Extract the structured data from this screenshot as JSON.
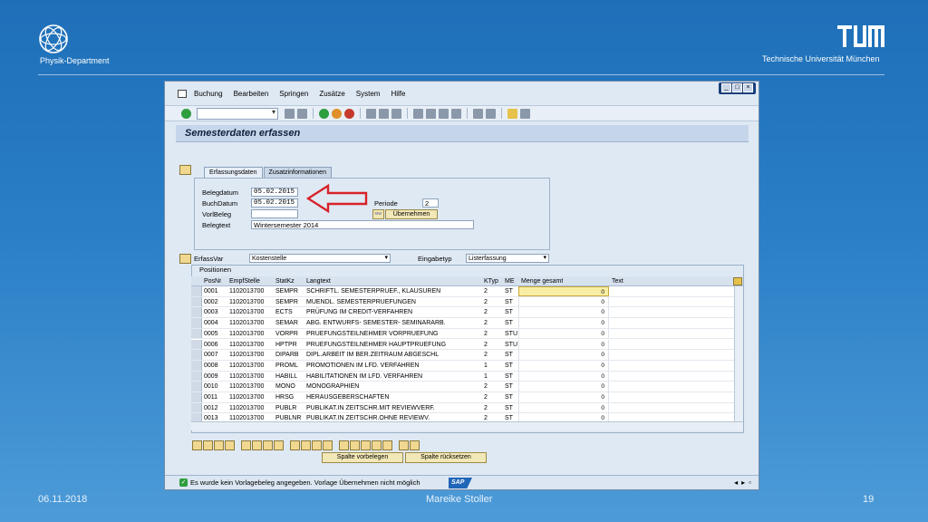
{
  "slide": {
    "department": "Physik-Department",
    "university": "Technische Universität München",
    "footer_date": "06.11.2018",
    "footer_author": "Mareike Stoller",
    "footer_page": "19"
  },
  "sap": {
    "menu": [
      "Buchung",
      "Bearbeiten",
      "Springen",
      "Zusätze",
      "System",
      "Hilfe"
    ],
    "title": "Semesterdaten erfassen",
    "tabs": [
      "Erfassungsdaten",
      "Zusatzinformationen"
    ],
    "form": {
      "belegdatum_label": "Belegdatum",
      "belegdatum_value": "05.02.2015",
      "buchdatum_label": "BuchDatum",
      "buchdatum_value": "05.02.2015",
      "vorlbeleg_label": "VorlBeleg",
      "belegtext_label": "Belegtext",
      "belegtext_value": "Wintersemester 2014",
      "periode_label": "Periode",
      "periode_value": "2",
      "uebernehmen_label": "Übernehmen"
    },
    "erfassvar_label": "ErfassVar",
    "erfassvar_value": "Kostenstelle",
    "eingabetyp_label": "Eingabetyp",
    "eingabetyp_value": "Listerfassung",
    "positions_title": "Positionen",
    "columns": [
      "PosNr",
      "EmpfStelle",
      "StatKz",
      "Langtext",
      "KTyp",
      "ME",
      "Menge gesamt",
      "Text"
    ],
    "rows": [
      {
        "posnr": "0001",
        "empf": "1102013700",
        "statkz": "SEMPR",
        "langtext": "SCHRIFTL. SEMESTERPRUEF., KLAUSUREN",
        "ktyp": "2",
        "me": "ST",
        "menge": "0"
      },
      {
        "posnr": "0002",
        "empf": "1102013700",
        "statkz": "SEMPR",
        "langtext": "MUENDL. SEMESTERPRUEFUNGEN",
        "ktyp": "2",
        "me": "ST",
        "menge": "0"
      },
      {
        "posnr": "0003",
        "empf": "1102013700",
        "statkz": "ECTS",
        "langtext": "PRÜFUNG IM CREDIT-VERFAHREN",
        "ktyp": "2",
        "me": "ST",
        "menge": "0"
      },
      {
        "posnr": "0004",
        "empf": "1102013700",
        "statkz": "SEMAR",
        "langtext": "ABG. ENTWURFS- SEMESTER- SEMINARARB.",
        "ktyp": "2",
        "me": "ST",
        "menge": "0"
      },
      {
        "posnr": "0005",
        "empf": "1102013700",
        "statkz": "VORPR",
        "langtext": "PRUEFUNGSTEILNEHMER VORPRUEFUNG",
        "ktyp": "2",
        "me": "STU",
        "menge": "0"
      },
      {
        "posnr": "0006",
        "empf": "1102013700",
        "statkz": "HPTPR",
        "langtext": "PRUEFUNGSTEILNEHMER HAUPTPRUEFUNG",
        "ktyp": "2",
        "me": "STU",
        "menge": "0"
      },
      {
        "posnr": "0007",
        "empf": "1102013700",
        "statkz": "DIPARB",
        "langtext": "DIPL.ARBEIT IM BER.ZEITRAUM ABGESCHL",
        "ktyp": "2",
        "me": "ST",
        "menge": "0"
      },
      {
        "posnr": "0008",
        "empf": "1102013700",
        "statkz": "PROML",
        "langtext": "PROMOTIONEN IM LFD. VERFAHREN",
        "ktyp": "1",
        "me": "ST",
        "menge": "0"
      },
      {
        "posnr": "0009",
        "empf": "1102013700",
        "statkz": "HABILL",
        "langtext": "HABILITATIONEN IM LFD. VERFAHREN",
        "ktyp": "1",
        "me": "ST",
        "menge": "0"
      },
      {
        "posnr": "0010",
        "empf": "1102013700",
        "statkz": "MONO",
        "langtext": "MONOGRAPHIEN",
        "ktyp": "2",
        "me": "ST",
        "menge": "0"
      },
      {
        "posnr": "0011",
        "empf": "1102013700",
        "statkz": "HRSG",
        "langtext": "HERAUSGEBERSCHAFTEN",
        "ktyp": "2",
        "me": "ST",
        "menge": "0"
      },
      {
        "posnr": "0012",
        "empf": "1102013700",
        "statkz": "PUBLR",
        "langtext": "PUBLIKAT.IN ZEITSCHR.MIT REVIEWVERF.",
        "ktyp": "2",
        "me": "ST",
        "menge": "0"
      },
      {
        "posnr": "0013",
        "empf": "1102013700",
        "statkz": "PUBLNR",
        "langtext": "PUBLIKAT.IN ZEITSCHR.OHNE REVIEWV.",
        "ktyp": "2",
        "me": "ST",
        "menge": "0"
      }
    ],
    "buttons": {
      "spalte_vorbelegen": "Spalte vorbelegen",
      "spalte_ruecksetzen": "Spalte rücksetzen"
    },
    "status_message": "Es wurde kein Vorlagebeleg angegeben. Vorlage Übernehmen nicht möglich",
    "sap_logo": "SAP"
  }
}
